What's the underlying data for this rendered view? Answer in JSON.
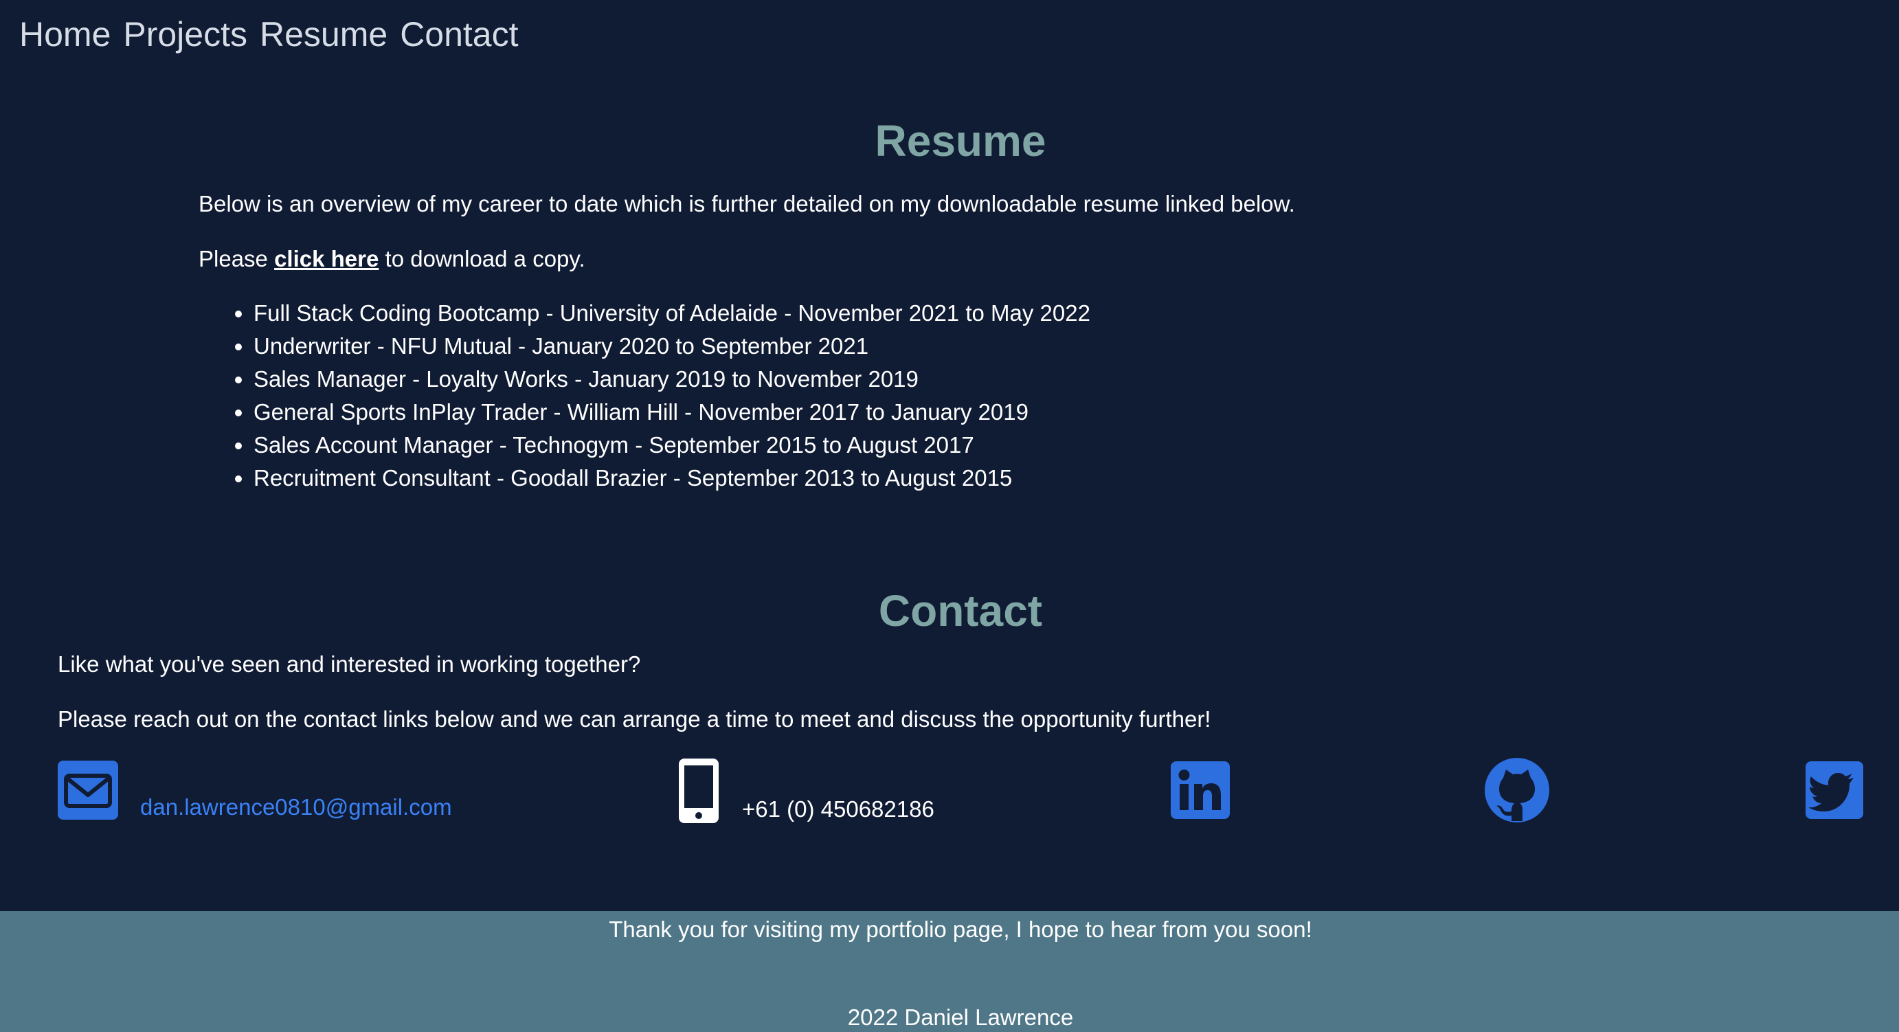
{
  "nav": {
    "items": [
      {
        "label": "Home"
      },
      {
        "label": "Projects"
      },
      {
        "label": "Resume"
      },
      {
        "label": "Contact"
      }
    ]
  },
  "resume": {
    "title": "Resume",
    "intro": "Below is an overview of my career to date which is further detailed on my downloadable resume linked below.",
    "download_prefix": "Please ",
    "download_link": "click here",
    "download_suffix": " to download a copy.",
    "items": [
      "Full Stack Coding Bootcamp - University of Adelaide - November 2021 to May 2022",
      "Underwriter - NFU Mutual - January 2020 to September 2021",
      "Sales Manager - Loyalty Works - January 2019 to November 2019",
      "General Sports InPlay Trader - William Hill - November 2017 to January 2019",
      "Sales Account Manager - Technogym - September 2015 to August 2017",
      "Recruitment Consultant - Goodall Brazier - September 2013 to August 2015"
    ]
  },
  "contact": {
    "title": "Contact",
    "line1": "Like what you've seen and interested in working together?",
    "line2": "Please reach out on the contact links below and we can arrange a time to meet and discuss the opportunity further!",
    "email": "dan.lawrence0810@gmail.com",
    "phone": "+61 (0) 450682186",
    "icons": {
      "email": "envelope-icon",
      "phone": "mobile-phone-icon",
      "linkedin": "linkedin-icon",
      "github": "github-icon",
      "twitter": "twitter-icon"
    },
    "icon_color": "#2e6fe0"
  },
  "footer": {
    "message": "Thank you for visiting my portfolio page, I hope to hear from you soon!",
    "copyright": "2022 Daniel Lawrence"
  },
  "colors": {
    "background": "#101b34",
    "heading": "#7fa6a4",
    "footer_bg": "#4f7788",
    "link": "#3b82f6"
  }
}
